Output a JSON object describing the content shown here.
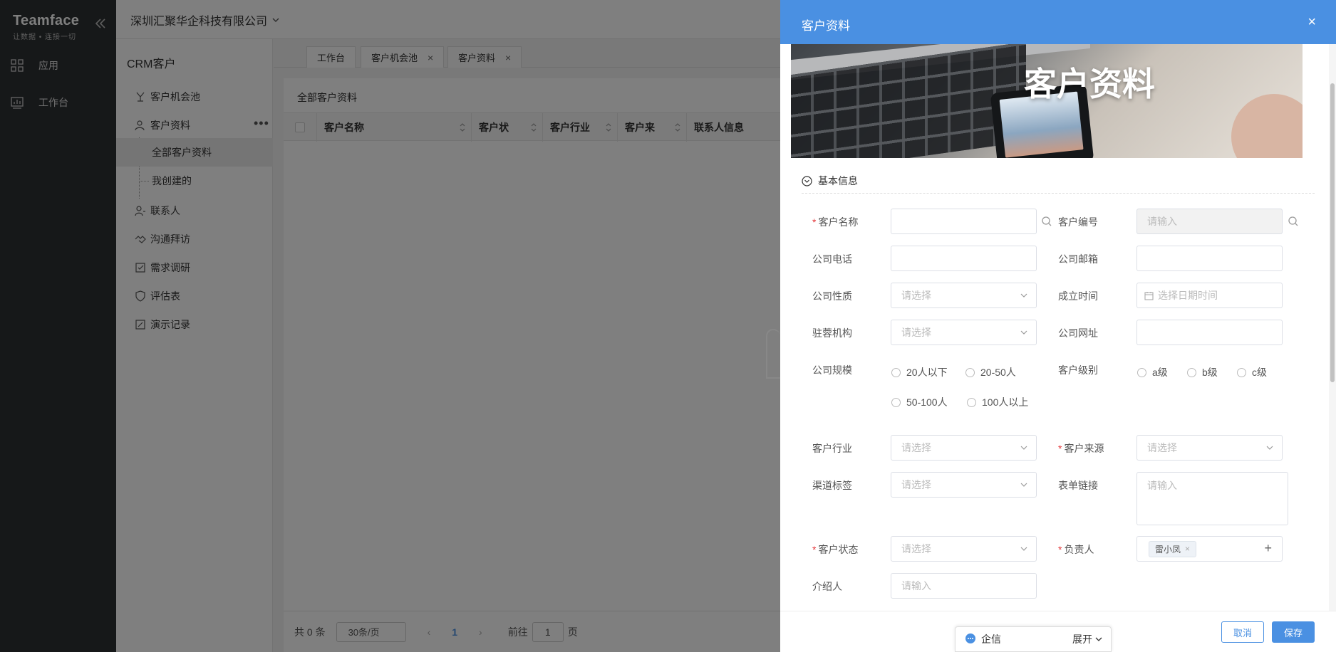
{
  "app": {
    "brand": "Teamface",
    "tagline": "让数据 • 连接一切",
    "nav": [
      {
        "label": "应用",
        "icon": "apps-icon"
      },
      {
        "label": "工作台",
        "icon": "dashboard-icon"
      }
    ]
  },
  "header": {
    "company": "深圳汇聚华企科技有限公司"
  },
  "crm": {
    "title": "CRM客户",
    "items": [
      {
        "label": "客户机会池",
        "icon": "pool-icon"
      },
      {
        "label": "客户资料",
        "icon": "user-icon"
      },
      {
        "label": "联系人",
        "icon": "contacts-icon"
      },
      {
        "label": "沟通拜访",
        "icon": "handshake-icon"
      },
      {
        "label": "需求调研",
        "icon": "survey-icon"
      },
      {
        "label": "评估表",
        "icon": "shield-icon"
      },
      {
        "label": "演示记录",
        "icon": "record-icon"
      }
    ],
    "subitems": [
      "全部客户资料",
      "我创建的"
    ],
    "more": "•••"
  },
  "tabs": [
    {
      "label": "工作台",
      "closable": false
    },
    {
      "label": "客户机会池",
      "closable": true
    },
    {
      "label": "客户资料",
      "closable": true
    }
  ],
  "main": {
    "title": "全部客户资料",
    "columns": [
      "客户名称",
      "客户状",
      "客户行业",
      "客户来",
      "联系人信息"
    ],
    "pager": {
      "total": "共 0 条",
      "page_size": "30条/页",
      "current": "1",
      "goto_prefix": "前往",
      "goto_value": "1",
      "goto_suffix": "页"
    }
  },
  "drawer": {
    "title": "客户资料",
    "close": "×",
    "banner_title": "客户资料",
    "section": "基本信息",
    "fields": {
      "customer_name": {
        "label": "客户名称",
        "value": ""
      },
      "customer_no": {
        "label": "客户编号",
        "placeholder": "请输入"
      },
      "phone": {
        "label": "公司电话",
        "value": ""
      },
      "email": {
        "label": "公司邮箱",
        "value": ""
      },
      "nature": {
        "label": "公司性质",
        "placeholder": "请选择"
      },
      "founded": {
        "label": "成立时间",
        "placeholder": "选择日期时间"
      },
      "agency": {
        "label": "驻蓉机构",
        "placeholder": "请选择"
      },
      "website": {
        "label": "公司网址",
        "value": ""
      },
      "scale": {
        "label": "公司规模",
        "options": [
          "20人以下",
          "20-50人",
          "50-100人",
          "100人以上"
        ]
      },
      "level": {
        "label": "客户级别",
        "options": [
          "a级",
          "b级",
          "c级"
        ]
      },
      "industry": {
        "label": "客户行业",
        "placeholder": "请选择"
      },
      "source": {
        "label": "客户来源",
        "placeholder": "请选择"
      },
      "channel": {
        "label": "渠道标签",
        "placeholder": "请选择"
      },
      "form_link": {
        "label": "表单链接",
        "placeholder": "请输入"
      },
      "status": {
        "label": "客户状态",
        "placeholder": "请选择"
      },
      "owner": {
        "label": "负责人",
        "tag": "雷小凤"
      },
      "referrer": {
        "label": "介绍人",
        "placeholder": "请输入"
      }
    },
    "buttons": {
      "cancel": "取消",
      "save": "保存"
    }
  },
  "chat": {
    "label": "企信",
    "expand": "展开"
  },
  "colors": {
    "primary": "#4a90e2",
    "sidebar": "#2d3033",
    "required": "#e4393c"
  }
}
